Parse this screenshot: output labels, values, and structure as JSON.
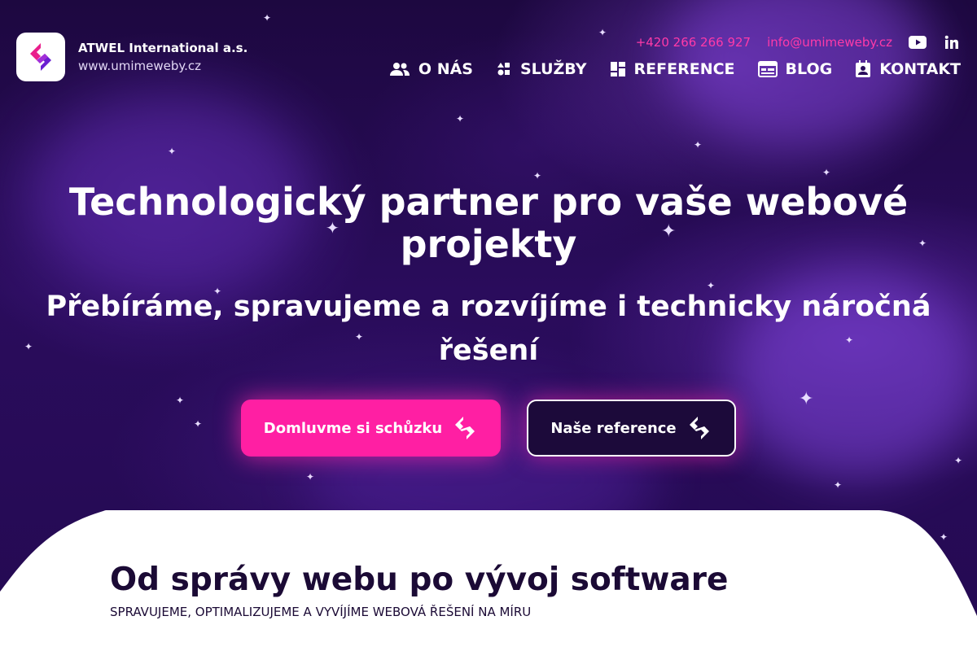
{
  "brand": {
    "company": "ATWEL International a.s.",
    "website": "www.umimeweby.cz",
    "logo_icon": "umimeweby-logo-icon"
  },
  "topbar": {
    "phone": "+420 266 266 927",
    "email": "info@umimeweby.cz",
    "social": [
      "youtube-icon",
      "linkedin-icon"
    ]
  },
  "nav": {
    "items": [
      {
        "label": "O NÁS",
        "icon": "people-icon"
      },
      {
        "label": "SLUŽBY",
        "icon": "services-icon"
      },
      {
        "label": "REFERENCE",
        "icon": "dashboard-icon"
      },
      {
        "label": "BLOG",
        "icon": "calendar-icon"
      },
      {
        "label": "KONTAKT",
        "icon": "contact-icon"
      }
    ]
  },
  "hero": {
    "headline": "Technologický partner pro vaše webové projekty",
    "subheadline": "Přebíráme, spravujeme a rozvíjíme i technicky náročná řešení",
    "primary_button": "Domluvme si schůzku",
    "secondary_button": "Naše reference"
  },
  "section": {
    "title": "Od správy webu po vývoj software",
    "subtitle": "SPRAVUJEME, OPTIMALIZUJEME A VYVÍJÍME WEBOVÁ ŘEŠENÍ NA MÍRU"
  },
  "colors": {
    "accent": "#ff1fa3",
    "background": "#2a0c5c",
    "text_dark": "#1b0a35"
  }
}
